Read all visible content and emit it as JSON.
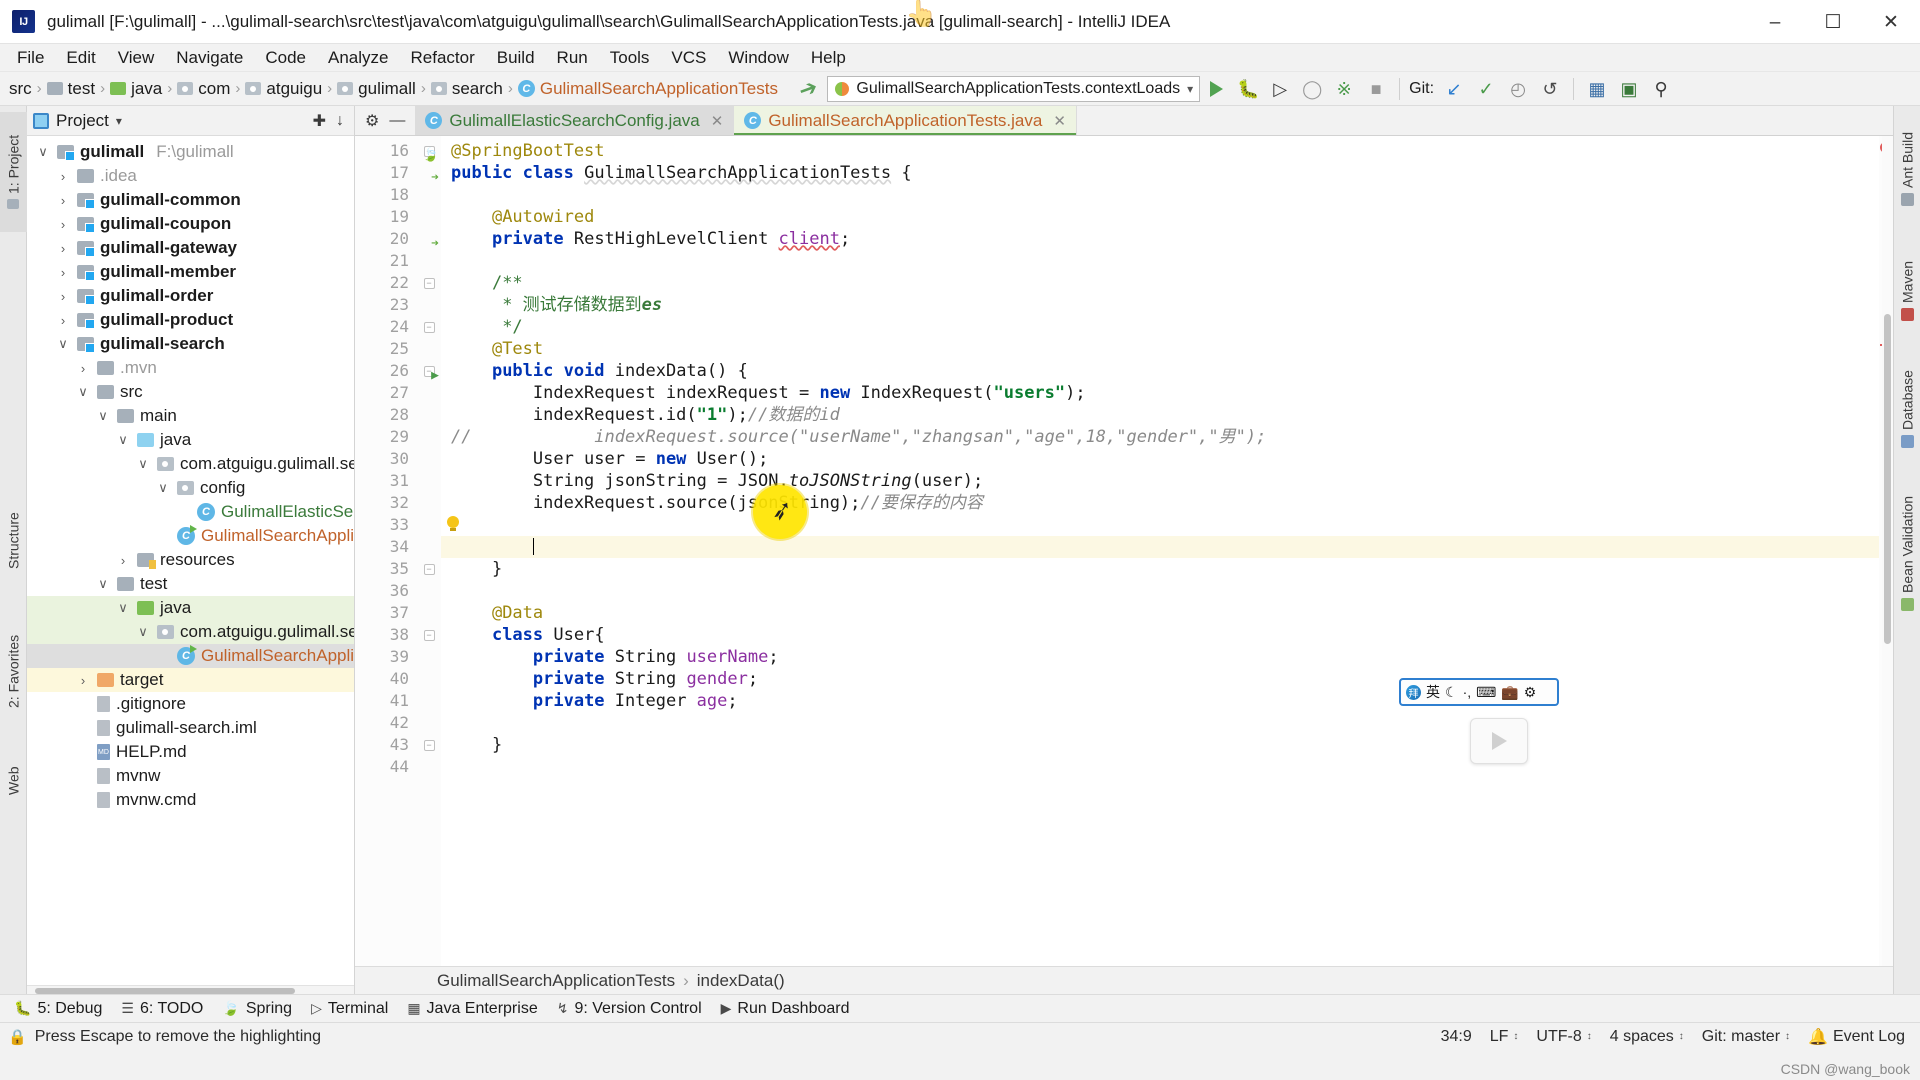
{
  "window": {
    "title": "gulimall [F:\\gulimall] - ...\\gulimall-search\\src\\test\\java\\com\\atguigu\\gulimall\\search\\GulimallSearchApplicationTests.java [gulimall-search] - IntelliJ IDEA",
    "minimize_label": "–",
    "maximize_label": "☐",
    "close_label": "✕",
    "logo_name": "intellij-idea-logo"
  },
  "menubar": [
    {
      "label": "File"
    },
    {
      "label": "Edit"
    },
    {
      "label": "View"
    },
    {
      "label": "Navigate"
    },
    {
      "label": "Code"
    },
    {
      "label": "Analyze"
    },
    {
      "label": "Refactor"
    },
    {
      "label": "Build"
    },
    {
      "label": "Run"
    },
    {
      "label": "Tools"
    },
    {
      "label": "VCS"
    },
    {
      "label": "Window"
    },
    {
      "label": "Help"
    }
  ],
  "breadcrumb": [
    {
      "label": "src",
      "icon": "none"
    },
    {
      "label": "test",
      "icon": "folder-gray"
    },
    {
      "label": "java",
      "icon": "folder-green"
    },
    {
      "label": "com",
      "icon": "package"
    },
    {
      "label": "atguigu",
      "icon": "package"
    },
    {
      "label": "gulimall",
      "icon": "package"
    },
    {
      "label": "search",
      "icon": "package"
    },
    {
      "label": "GulimallSearchApplicationTests",
      "icon": "java-class"
    }
  ],
  "toolbar": {
    "run_config": "GulimallSearchApplicationTests.contextLoads",
    "git_label": "Git:",
    "buttons": [
      {
        "name": "run-button",
        "glyph": "▶"
      },
      {
        "name": "debug-button",
        "glyph": "🐞"
      },
      {
        "name": "run-with-coverage-button",
        "glyph": "▷"
      },
      {
        "name": "profiler-button",
        "glyph": "◌"
      },
      {
        "name": "attach-debugger-button",
        "glyph": "⬚"
      },
      {
        "name": "stop-button",
        "glyph": "■"
      }
    ],
    "git_buttons": [
      {
        "name": "update-project-button",
        "glyph": "↙"
      },
      {
        "name": "commit-button",
        "glyph": "✓"
      },
      {
        "name": "history-button",
        "glyph": "◴"
      },
      {
        "name": "rollback-button",
        "glyph": "↺"
      }
    ],
    "right_buttons": [
      {
        "name": "database-button",
        "glyph": "▦"
      },
      {
        "name": "terminal-button",
        "glyph": "▣"
      },
      {
        "name": "search-everywhere-button",
        "glyph": "⚲"
      }
    ]
  },
  "project_panel": {
    "title": "Project",
    "actions": [
      {
        "name": "locate-in-tree-button",
        "glyph": "⊕"
      },
      {
        "name": "collapse-all-button",
        "glyph": "⤓"
      },
      {
        "name": "settings-button",
        "glyph": "⚙"
      },
      {
        "name": "hide-panel-button",
        "glyph": "−"
      }
    ],
    "tree": [
      {
        "depth": 0,
        "arrow": "down",
        "icon": "module",
        "label": "gulimall",
        "bold": true,
        "path": "F:\\gulimall",
        "highlight": ""
      },
      {
        "depth": 1,
        "arrow": "right",
        "icon": "folder-gray",
        "label": ".idea",
        "bold": false,
        "dim": true,
        "highlight": ""
      },
      {
        "depth": 1,
        "arrow": "right",
        "icon": "module",
        "label": "gulimall-common",
        "bold": true,
        "highlight": ""
      },
      {
        "depth": 1,
        "arrow": "right",
        "icon": "module",
        "label": "gulimall-coupon",
        "bold": true,
        "highlight": ""
      },
      {
        "depth": 1,
        "arrow": "right",
        "icon": "module",
        "label": "gulimall-gateway",
        "bold": true,
        "highlight": ""
      },
      {
        "depth": 1,
        "arrow": "right",
        "icon": "module",
        "label": "gulimall-member",
        "bold": true,
        "highlight": ""
      },
      {
        "depth": 1,
        "arrow": "right",
        "icon": "module",
        "label": "gulimall-order",
        "bold": true,
        "highlight": ""
      },
      {
        "depth": 1,
        "arrow": "right",
        "icon": "module",
        "label": "gulimall-product",
        "bold": true,
        "highlight": ""
      },
      {
        "depth": 1,
        "arrow": "down",
        "icon": "module",
        "label": "gulimall-search",
        "bold": true,
        "highlight": ""
      },
      {
        "depth": 2,
        "arrow": "right",
        "icon": "folder-gray",
        "label": ".mvn",
        "dim": true,
        "highlight": ""
      },
      {
        "depth": 2,
        "arrow": "down",
        "icon": "folder-gray",
        "label": "src",
        "highlight": ""
      },
      {
        "depth": 3,
        "arrow": "down",
        "icon": "folder-gray",
        "label": "main",
        "highlight": ""
      },
      {
        "depth": 4,
        "arrow": "down",
        "icon": "folder-blue",
        "label": "java",
        "highlight": ""
      },
      {
        "depth": 5,
        "arrow": "down",
        "icon": "package",
        "label": "com.atguigu.gulimall.sear",
        "highlight": ""
      },
      {
        "depth": 6,
        "arrow": "down",
        "icon": "package",
        "label": "config",
        "highlight": ""
      },
      {
        "depth": 7,
        "arrow": "none",
        "icon": "java-class",
        "label": "GulimallElasticSear",
        "color": "green",
        "highlight": ""
      },
      {
        "depth": 6,
        "arrow": "none",
        "icon": "java-class-run",
        "label": "GulimallSearchApplica",
        "color": "orange",
        "highlight": ""
      },
      {
        "depth": 4,
        "arrow": "right",
        "icon": "folder-resources",
        "label": "resources",
        "highlight": ""
      },
      {
        "depth": 3,
        "arrow": "down",
        "icon": "folder-gray",
        "label": "test",
        "highlight": ""
      },
      {
        "depth": 4,
        "arrow": "down",
        "icon": "folder-green",
        "label": "java",
        "highlight": "green"
      },
      {
        "depth": 5,
        "arrow": "down",
        "icon": "package",
        "label": "com.atguigu.gulimall.sear",
        "highlight": "green"
      },
      {
        "depth": 6,
        "arrow": "none",
        "icon": "java-class-run",
        "label": "GulimallSearchApplica",
        "color": "orange",
        "highlight": "gray"
      },
      {
        "depth": 2,
        "arrow": "right",
        "icon": "folder-orange",
        "label": "target",
        "highlight": "yellow"
      },
      {
        "depth": 2,
        "arrow": "none",
        "icon": "file",
        "label": ".gitignore",
        "highlight": ""
      },
      {
        "depth": 2,
        "arrow": "none",
        "icon": "file",
        "label": "gulimall-search.iml",
        "highlight": ""
      },
      {
        "depth": 2,
        "arrow": "none",
        "icon": "file-md",
        "label": "HELP.md",
        "highlight": ""
      },
      {
        "depth": 2,
        "arrow": "none",
        "icon": "file",
        "label": "mvnw",
        "highlight": ""
      },
      {
        "depth": 2,
        "arrow": "none",
        "icon": "file",
        "label": "mvnw.cmd",
        "highlight": ""
      }
    ]
  },
  "left_tool_strip": [
    {
      "label": "1: Project",
      "selected": true
    },
    {
      "label": "Structure",
      "selected": false
    },
    {
      "label": "2: Favorites",
      "selected": false
    },
    {
      "label": "Web",
      "selected": false
    }
  ],
  "right_tool_strip": [
    {
      "label": "Ant Build"
    },
    {
      "label": "Maven"
    },
    {
      "label": "Database"
    },
    {
      "label": "Bean Validation"
    }
  ],
  "editor": {
    "tabs": [
      {
        "label": "GulimallElasticSearchConfig.java",
        "active": false,
        "color": "green",
        "closable": true
      },
      {
        "label": "GulimallSearchApplicationTests.java",
        "active": true,
        "color": "orange",
        "closable": true
      }
    ],
    "first_line": 16,
    "current_line": 34,
    "lines": [
      {
        "n": 16,
        "gutter_icon": "spring-leaf",
        "fold": "fold-open",
        "html": "<span class=\"ann\">@SpringBootTest</span>"
      },
      {
        "n": 17,
        "gutter_icon": "spring-bean",
        "fold": "",
        "html": "<span class=\"k\">public class</span> <span class=\"warnu\">GulimallSearchApplicationTests</span> {"
      },
      {
        "n": 18,
        "gutter_icon": "",
        "fold": "",
        "html": ""
      },
      {
        "n": 19,
        "gutter_icon": "",
        "fold": "",
        "html": "    <span class=\"ann\">@Autowired</span>"
      },
      {
        "n": 20,
        "gutter_icon": "spring-bean",
        "fold": "",
        "html": "    <span class=\"k\">private</span> RestHighLevelClient <span class=\"fld erru\">client</span>;"
      },
      {
        "n": 21,
        "gutter_icon": "",
        "fold": "",
        "html": ""
      },
      {
        "n": 22,
        "gutter_icon": "",
        "fold": "fold-open",
        "html": "    <span class=\"cmt-doc\">/**</span>"
      },
      {
        "n": 23,
        "gutter_icon": "",
        "fold": "",
        "html": "     <span class=\"cmt-doc\">* 测试存储数据到</span><span class=\"cmt-doc\" style=\"font-style:italic;font-weight:bold\">es</span>"
      },
      {
        "n": 24,
        "gutter_icon": "",
        "fold": "fold-close",
        "html": "     <span class=\"cmt-doc\">*/</span>"
      },
      {
        "n": 25,
        "gutter_icon": "",
        "fold": "",
        "html": "    <span class=\"ann\">@Test</span>"
      },
      {
        "n": 26,
        "gutter_icon": "run-test",
        "fold": "fold-open",
        "html": "    <span class=\"k\">public void</span> indexData() {"
      },
      {
        "n": 27,
        "gutter_icon": "",
        "fold": "",
        "html": "        IndexRequest indexRequest = <span class=\"k\">new</span> IndexRequest(<span class=\"str\">\"users\"</span>);"
      },
      {
        "n": 28,
        "gutter_icon": "",
        "fold": "",
        "html": "        indexRequest.id(<span class=\"str\">\"1\"</span>);<span class=\"cmt\">//数据的</span><span class=\"cmt\">id</span>"
      },
      {
        "n": 29,
        "gutter_icon": "",
        "fold": "",
        "comment_prefix": "//",
        "html": "<span class=\"cmt\">            indexRequest.source(\"userName\",\"zhangsan\",\"age\",18,\"gender\",\"男\");</span>"
      },
      {
        "n": 30,
        "gutter_icon": "",
        "fold": "",
        "html": "        User user = <span class=\"k\">new</span> User();"
      },
      {
        "n": 31,
        "gutter_icon": "",
        "fold": "",
        "html": "        String jsonString = JSON.<span class=\"mth\">toJSONString</span>(user);"
      },
      {
        "n": 32,
        "gutter_icon": "",
        "fold": "",
        "html": "        indexRequest.source(jsonString);<span class=\"cmt\">//要保存的内容</span>"
      },
      {
        "n": 33,
        "gutter_icon": "intention-bulb",
        "fold": "",
        "html": ""
      },
      {
        "n": 34,
        "gutter_icon": "",
        "fold": "",
        "current": true,
        "html": "        <span class=\"caret\"></span>"
      },
      {
        "n": 35,
        "gutter_icon": "",
        "fold": "fold-close",
        "html": "    }"
      },
      {
        "n": 36,
        "gutter_icon": "",
        "fold": "",
        "html": ""
      },
      {
        "n": 37,
        "gutter_icon": "",
        "fold": "",
        "html": "    <span class=\"ann\">@Data</span>"
      },
      {
        "n": 38,
        "gutter_icon": "",
        "fold": "fold-open",
        "html": "    <span class=\"k\">class</span> User{"
      },
      {
        "n": 39,
        "gutter_icon": "",
        "fold": "",
        "html": "        <span class=\"k\">private</span> String <span class=\"fld\">userName</span>;"
      },
      {
        "n": 40,
        "gutter_icon": "",
        "fold": "",
        "html": "        <span class=\"k\">private</span> String <span class=\"fld\">gender</span>;"
      },
      {
        "n": 41,
        "gutter_icon": "",
        "fold": "",
        "html": "        <span class=\"k\">private</span> Integer <span class=\"fld\">age</span>;"
      },
      {
        "n": 42,
        "gutter_icon": "",
        "fold": "",
        "html": ""
      },
      {
        "n": 43,
        "gutter_icon": "",
        "fold": "fold-close",
        "html": "    }"
      },
      {
        "n": 44,
        "gutter_icon": "",
        "fold": "",
        "html": ""
      }
    ],
    "crumb": [
      "GulimallSearchApplicationTests",
      "indexData()"
    ]
  },
  "bottom_toolwindows": [
    {
      "label": "5: Debug",
      "icon": "bug-icon"
    },
    {
      "label": "6: TODO",
      "icon": "list-icon"
    },
    {
      "label": "Spring",
      "icon": "leaf-icon"
    },
    {
      "label": "Terminal",
      "icon": "terminal-icon"
    },
    {
      "label": "Java Enterprise",
      "icon": "enterprise-icon"
    },
    {
      "label": "9: Version Control",
      "icon": "branch-icon"
    },
    {
      "label": "Run Dashboard",
      "icon": "play-icon"
    }
  ],
  "statusbar": {
    "message": "Press Escape to remove the highlighting",
    "caret_position": "34:9",
    "line_separator": "LF",
    "encoding": "UTF-8",
    "indent": "4 spaces",
    "git_branch": "Git: master",
    "event_log": "Event Log"
  },
  "overlays": {
    "ime": {
      "lang": "英",
      "items": [
        "☽",
        "…",
        "⌨",
        "▰",
        "⚙"
      ]
    },
    "watermark": "CSDN @wang_book"
  },
  "colors": {
    "accent_green": "#5fa24e",
    "keyword_blue": "#0033b3",
    "string_green": "#0a7c2f",
    "annotation_gold": "#9e880d",
    "field_purple": "#8b2fa0",
    "comment_gray": "#8a8a8a",
    "doc_green": "#3a7a3a",
    "current_line": "#fcf8e3",
    "tab_active": "#eef4e2",
    "error_red": "#e05c5c"
  }
}
